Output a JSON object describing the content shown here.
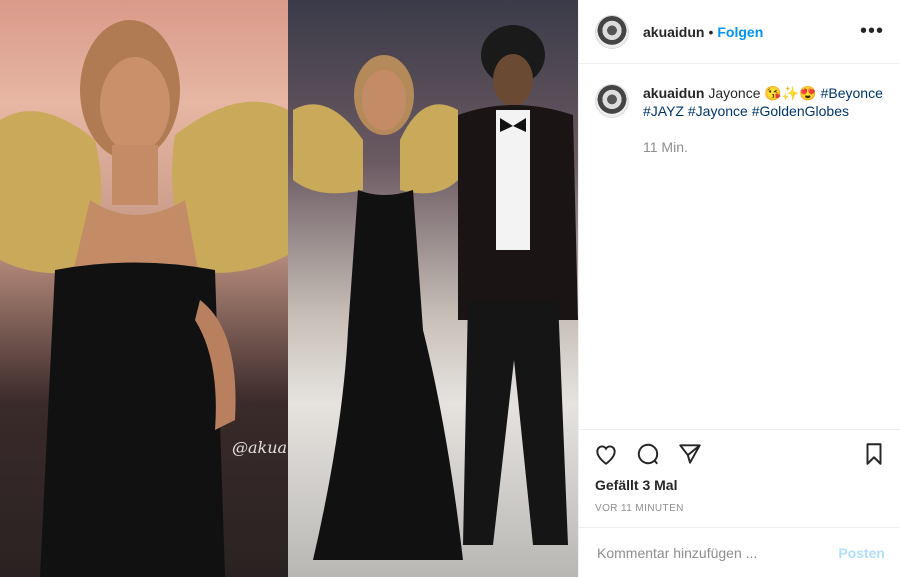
{
  "header": {
    "username": "akuaidun",
    "separator": "•",
    "follow_label": "Folgen",
    "more_label": "•••"
  },
  "caption": {
    "username": "akuaidun",
    "text": "Jayonce 😘✨😍",
    "hashtags": [
      "#Beyonce",
      "#JAYZ",
      "#Jayonce",
      "#GoldenGlobes"
    ],
    "time": "11 Min."
  },
  "media": {
    "watermark": "@akuaidun"
  },
  "icons": {
    "like": "heart-icon",
    "comment": "comment-icon",
    "share": "share-icon",
    "save": "bookmark-icon"
  },
  "stats": {
    "likes": "Gefällt 3 Mal",
    "posted_ago": "VOR 11 MINUTEN"
  },
  "comment": {
    "placeholder": "Kommentar hinzufügen ...",
    "post_label": "Posten"
  },
  "colors": {
    "accent": "#0095f6",
    "hashtag": "#00376b",
    "post_disabled": "#b2dffc"
  }
}
